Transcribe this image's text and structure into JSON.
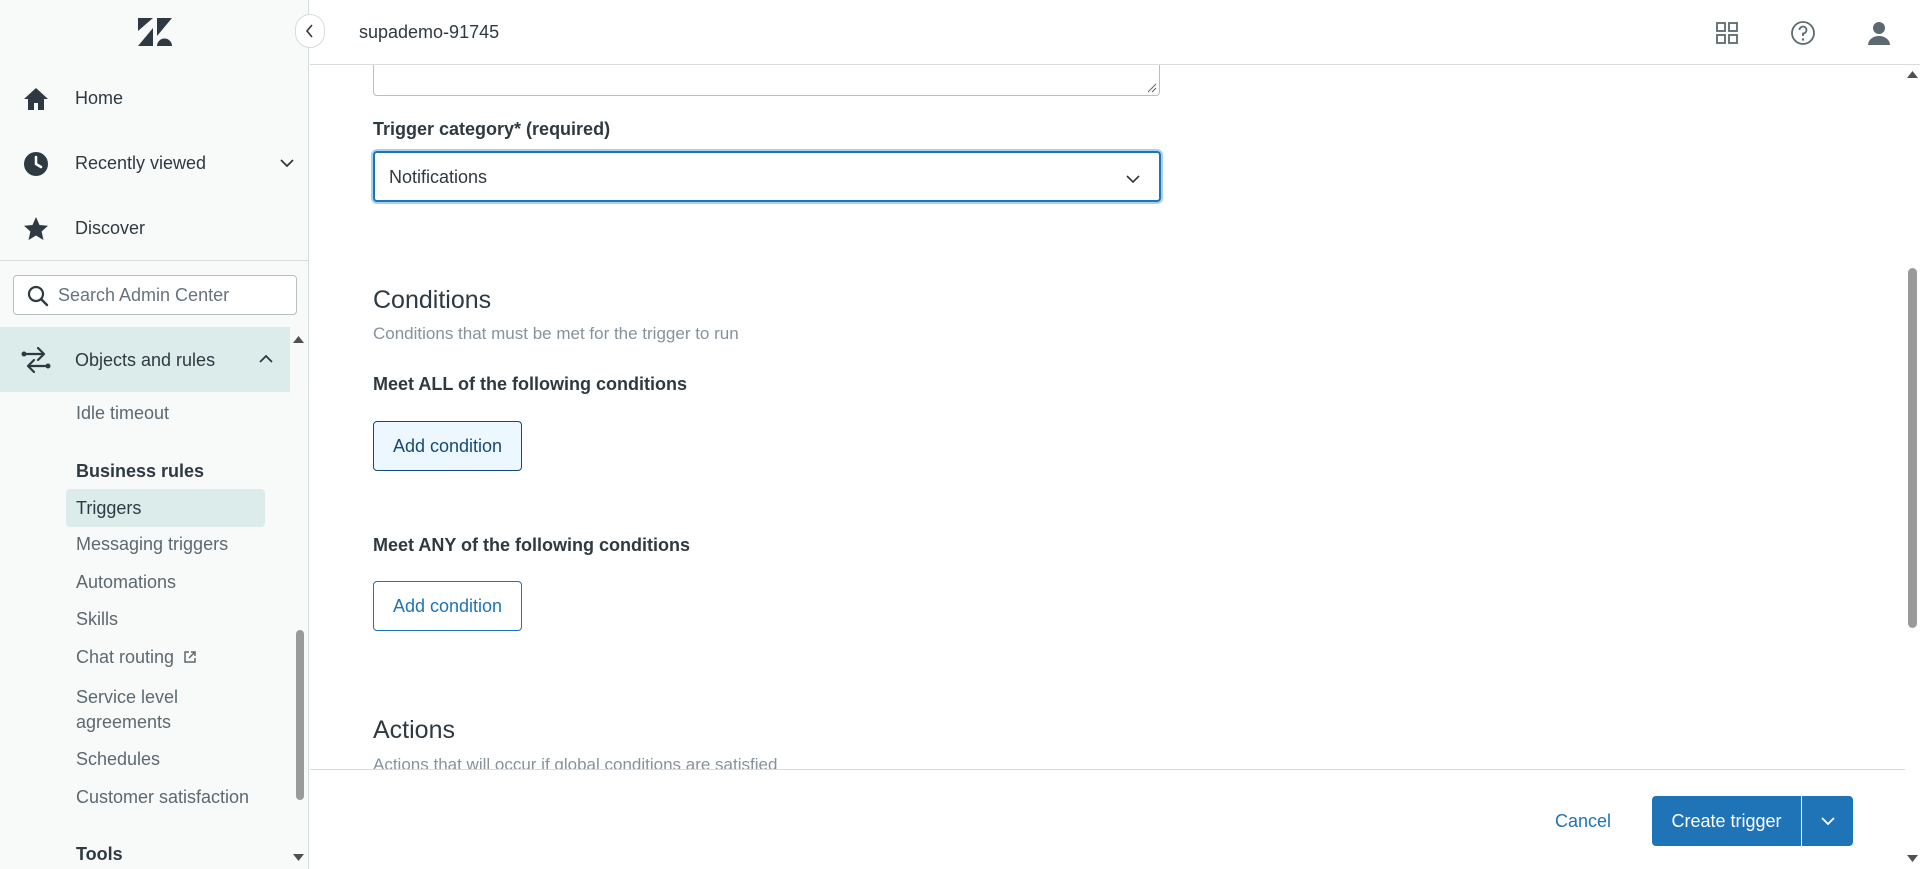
{
  "app": {
    "account": "supademo-91745"
  },
  "sidebar": {
    "nav": [
      {
        "label": "Home",
        "icon": "home-icon"
      },
      {
        "label": "Recently viewed",
        "icon": "clock-icon"
      },
      {
        "label": "Discover",
        "icon": "star-icon"
      }
    ],
    "search_placeholder": "Search Admin Center",
    "section": {
      "label": "Objects and rules",
      "icon": "objects-rules-icon"
    },
    "items": {
      "idle_timeout": "Idle timeout",
      "business_rules": "Business rules",
      "triggers": "Triggers",
      "messaging_triggers": "Messaging triggers",
      "automations": "Automations",
      "skills": "Skills",
      "chat_routing": "Chat routing",
      "sla_line1": "Service level",
      "sla_line2": "agreements",
      "schedules": "Schedules",
      "customer_satisfaction": "Customer satisfaction",
      "tools": "Tools"
    }
  },
  "form": {
    "category_label": "Trigger category* (required)",
    "category_value": "Notifications",
    "conditions_title": "Conditions",
    "conditions_hint": "Conditions that must be met for the trigger to run",
    "all_label": "Meet ALL of the following conditions",
    "any_label": "Meet ANY of the following conditions",
    "add_condition": "Add condition",
    "actions_title": "Actions",
    "actions_hint": "Actions that will occur if global conditions are satisfied"
  },
  "footer": {
    "cancel": "Cancel",
    "create": "Create trigger"
  },
  "colors": {
    "accent": "#1f73b7",
    "active_bg": "#dbeceb",
    "sidebar_bg": "#f8f9f9"
  }
}
